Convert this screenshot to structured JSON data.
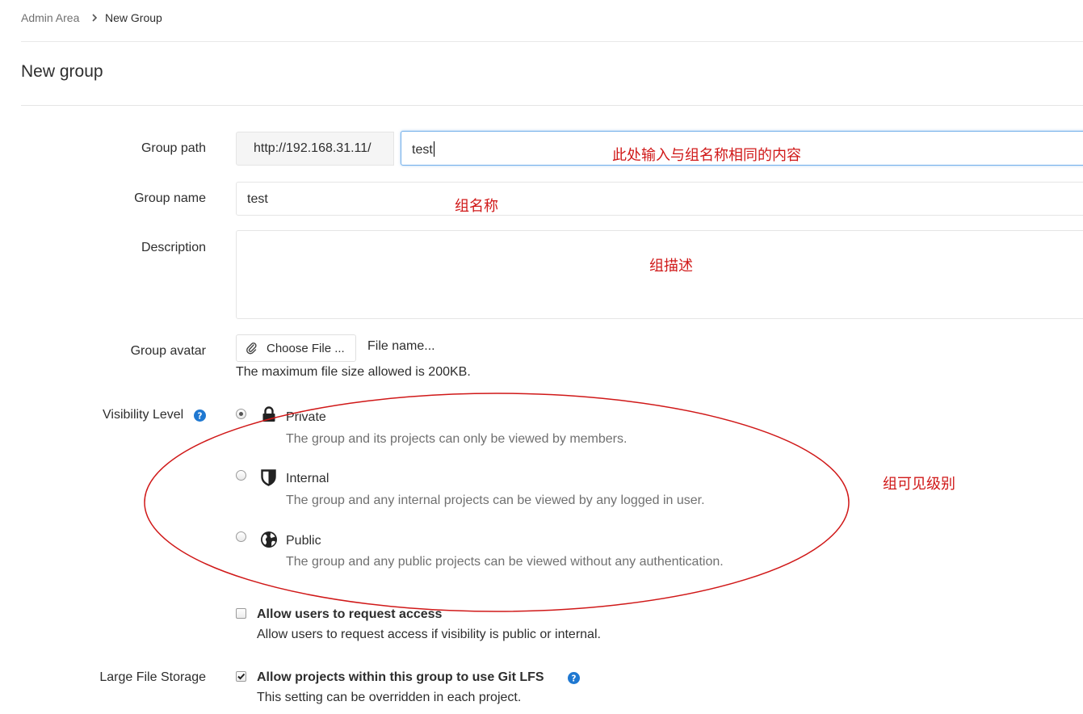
{
  "breadcrumb": {
    "parent": "Admin Area",
    "current": "New Group"
  },
  "page_title": "New group",
  "form": {
    "group_path": {
      "label": "Group path",
      "prefix": "http://192.168.31.11/",
      "value": "test",
      "annotation": "此处输入与组名称相同的内容"
    },
    "group_name": {
      "label": "Group name",
      "value": "test",
      "annotation": "组名称"
    },
    "description": {
      "label": "Description",
      "value": "",
      "annotation": "组描述"
    },
    "group_avatar": {
      "label": "Group avatar",
      "button": "Choose File ...",
      "file_name": "File name...",
      "hint": "The maximum file size allowed is 200KB."
    },
    "visibility": {
      "label": "Visibility Level",
      "annotation": "组可见级别",
      "selected": "Private",
      "options": [
        {
          "title": "Private",
          "description": "The group and its projects can only be viewed by members.",
          "icon": "lock-icon"
        },
        {
          "title": "Internal",
          "description": "The group and any internal projects can be viewed by any logged in user.",
          "icon": "shield-icon"
        },
        {
          "title": "Public",
          "description": "The group and any public projects can be viewed without any authentication.",
          "icon": "globe-icon"
        }
      ]
    },
    "request_access": {
      "title": "Allow users to request access",
      "description": "Allow users to request access if visibility is public or internal.",
      "checked": false
    },
    "lfs": {
      "label": "Large File Storage",
      "title": "Allow projects within this group to use Git LFS",
      "description": "This setting can be overridden in each project.",
      "checked": true
    }
  },
  "colors": {
    "annotation": "#d01818",
    "help_icon": "#1f78d1",
    "focus_border": "#73afea"
  }
}
